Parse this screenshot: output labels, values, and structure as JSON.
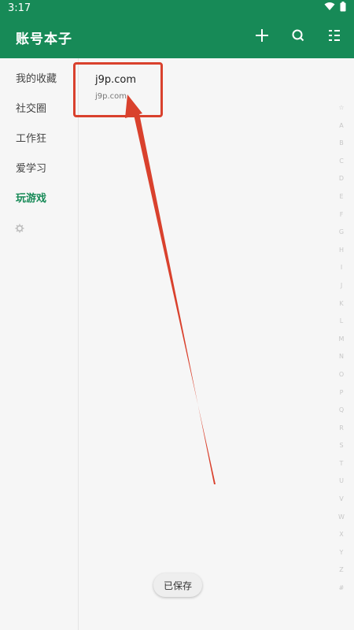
{
  "status": {
    "time": "3:17"
  },
  "appbar": {
    "title": "账号本子",
    "icons": [
      "add-icon",
      "search-icon",
      "sort-list-icon"
    ]
  },
  "sidebar": {
    "items": [
      {
        "label": "我的收藏"
      },
      {
        "label": "社交圈"
      },
      {
        "label": "工作狂"
      },
      {
        "label": "爱学习"
      },
      {
        "label": "玩游戏",
        "active": true
      }
    ],
    "settings_icon": "gear-icon"
  },
  "entry": {
    "title": "j9p.com",
    "subtitle": "j9p.com"
  },
  "alphabet": [
    "☆",
    "A",
    "B",
    "C",
    "D",
    "E",
    "F",
    "G",
    "H",
    "I",
    "J",
    "K",
    "L",
    "M",
    "N",
    "O",
    "P",
    "Q",
    "R",
    "S",
    "T",
    "U",
    "V",
    "W",
    "X",
    "Y",
    "Z",
    "#"
  ],
  "toast": {
    "text": "已保存"
  },
  "colors": {
    "primary": "#178a57",
    "annotation": "#d9412d"
  }
}
